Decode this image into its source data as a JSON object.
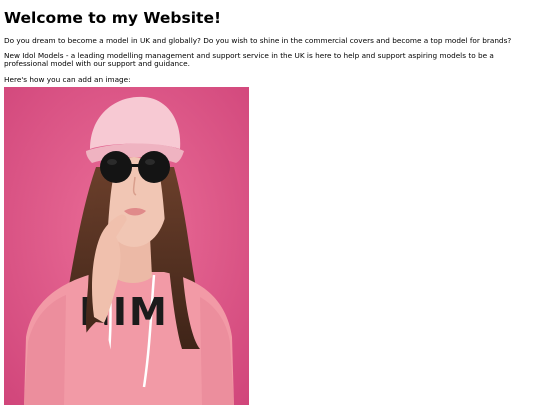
{
  "page": {
    "heading": "Welcome to my Website!",
    "paragraphs": [
      "Do you dream to become a model in UK and globally? Do you wish to shine in the commercial covers and become a top model for brands?",
      "New Idol Models - a leading modelling management and support service in the UK is here to help and support aspiring models to be a professional model with our support and guidance.",
      "Here's how you can add an image:"
    ]
  },
  "image": {
    "subject": "model-photo",
    "sweatshirt_text": "NIM",
    "colors": {
      "background": "#e05a8a",
      "cap": "#f7c9d3",
      "sweatshirt": "#f29aa6",
      "hair": "#5a3526",
      "skin": "#f1c6b4",
      "sunglasses": "#141414"
    }
  }
}
